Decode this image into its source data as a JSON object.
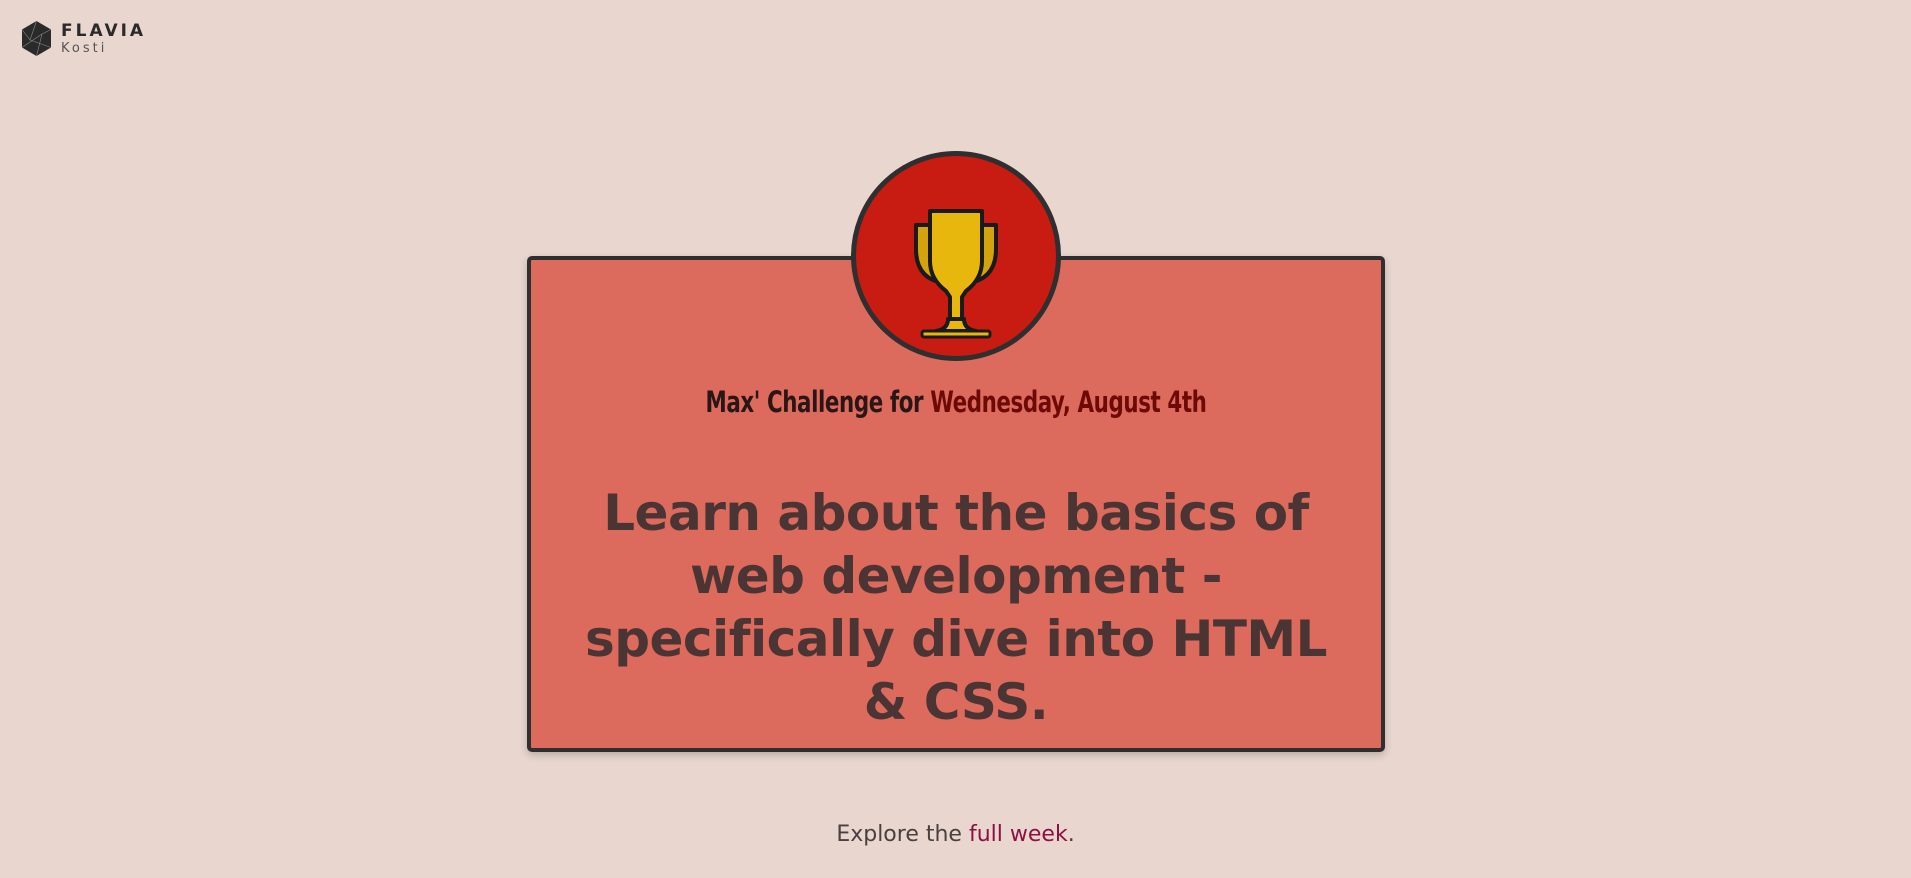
{
  "logo": {
    "name": "FLAVIA",
    "sub": "Kosti"
  },
  "card": {
    "heading_prefix": "Max' Challenge for ",
    "heading_date": "Wednesday, August 4th",
    "challenge": "Learn about the basics of web development - specifically dive into HTML & CSS.",
    "badge_icon": "trophy-icon"
  },
  "footer": {
    "explore_prefix": "Explore the ",
    "explore_link": "full week",
    "explore_suffix": "."
  },
  "colors": {
    "background": "#e8d6cf",
    "card": "#dd6b5d",
    "badge": "#c81c12",
    "trophy": "#e8b70e",
    "date": "#6e0a06",
    "link": "#8e1045"
  }
}
